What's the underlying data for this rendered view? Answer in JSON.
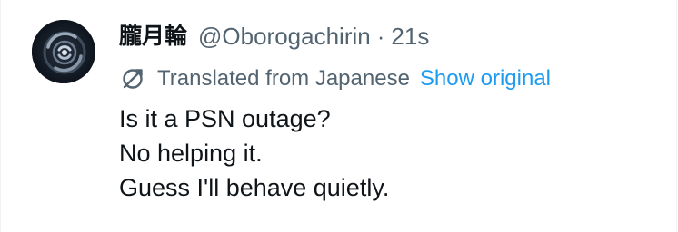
{
  "author": {
    "display_name": "朧月輪",
    "handle": "@Oborogachirin",
    "separator": "·",
    "time": "21s",
    "avatar_icon": "circular-swirl-avatar"
  },
  "translation": {
    "icon": "translate-globe-icon",
    "label": "Translated from Japanese",
    "show_original_label": "Show original"
  },
  "body": {
    "lines": [
      "Is it a PSN outage?",
      "No helping it.",
      "Guess I'll behave quietly."
    ]
  },
  "colors": {
    "text_primary": "#0f1419",
    "text_secondary": "#536471",
    "link": "#1d9bf0",
    "avatar_bg": "#131a24"
  }
}
